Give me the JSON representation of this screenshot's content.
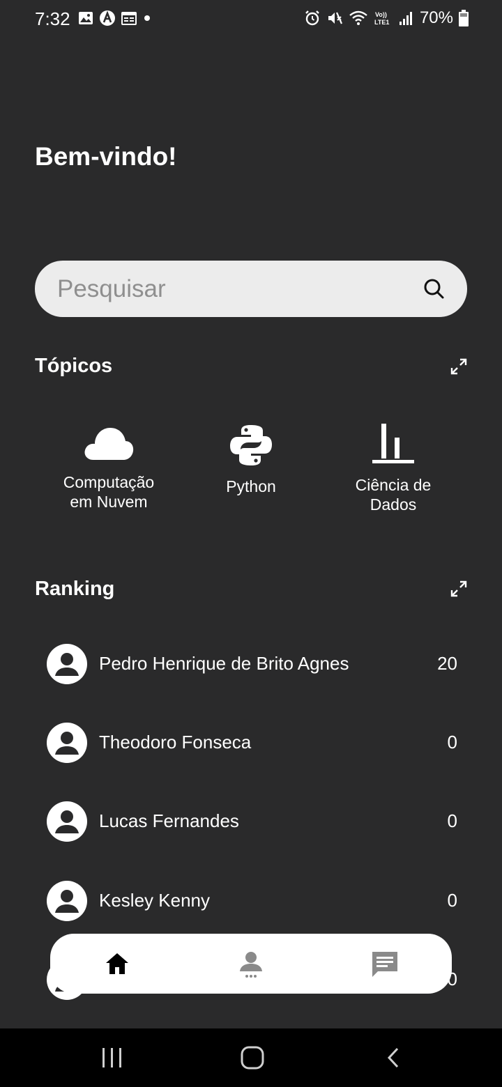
{
  "status_bar": {
    "time": "7:32",
    "battery": "70%",
    "left_icons": [
      "gallery-icon",
      "a-icon",
      "calendar-icon",
      "dot-icon"
    ],
    "right_icons": [
      "alarm-icon",
      "mute-icon",
      "wifi-icon",
      "volte-icon",
      "signal-icon",
      "battery-icon"
    ]
  },
  "header": {
    "title": "Bem-vindo!"
  },
  "search": {
    "placeholder": "Pesquisar",
    "value": ""
  },
  "topics": {
    "title": "Tópicos",
    "items": [
      {
        "label": "Computação\nem Nuvem",
        "icon": "cloud-icon"
      },
      {
        "label": "Python",
        "icon": "python-icon"
      },
      {
        "label": "Ciência de\nDados",
        "icon": "bar-chart-icon"
      }
    ]
  },
  "ranking": {
    "title": "Ranking",
    "items": [
      {
        "name": "Pedro Henrique de Brito Agnes",
        "score": "20"
      },
      {
        "name": "Theodoro Fonseca",
        "score": "0"
      },
      {
        "name": "Lucas Fernandes",
        "score": "0"
      },
      {
        "name": "Kesley Kenny",
        "score": "0"
      },
      {
        "name": "",
        "score": "0"
      }
    ]
  },
  "bottom_nav": {
    "items": [
      {
        "icon": "home-icon",
        "active": true
      },
      {
        "icon": "profile-icon",
        "active": false
      },
      {
        "icon": "chat-icon",
        "active": false
      }
    ]
  },
  "colors": {
    "background": "#2a2a2b",
    "search_bg": "#ececec",
    "nav_bg": "#ffffff",
    "system_nav_bg": "#000000"
  }
}
